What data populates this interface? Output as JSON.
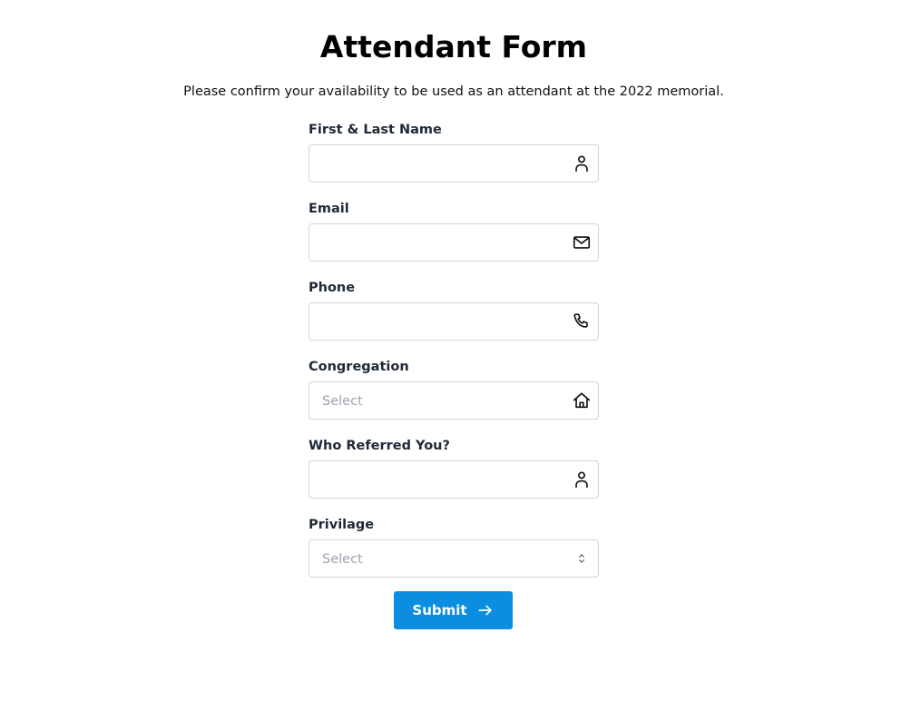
{
  "form": {
    "title": "Attendant Form",
    "subtitle": "Please confirm your availability to be used as an attendant at the 2022 memorial.",
    "fields": [
      {
        "label": "First & Last Name",
        "value": "",
        "icon": "person-icon"
      },
      {
        "label": "Email",
        "value": "",
        "icon": "envelope-icon"
      },
      {
        "label": "Phone",
        "value": "",
        "icon": "phone-icon"
      },
      {
        "label": "Congregation",
        "value": "",
        "placeholder": "Select",
        "icon": "house-icon"
      },
      {
        "label": "Who Referred You?",
        "value": "",
        "icon": "person-icon"
      },
      {
        "label": "Privilage",
        "value": "",
        "placeholder": "Select",
        "icon": "chevron-up-down-icon"
      }
    ],
    "submit_label": "Submit",
    "submit_icon": "arrow-right-icon",
    "accent_color": "#0b8ee0"
  }
}
